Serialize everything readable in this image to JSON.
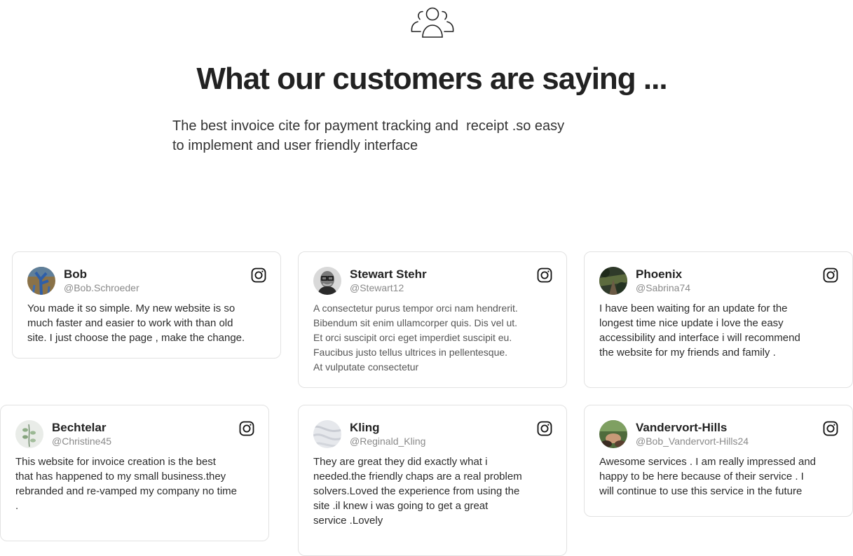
{
  "header": {
    "icon": "users-icon",
    "title": "What our customers are saying ...",
    "subtitle": "The best invoice cite for payment tracking and  receipt .so easy\nto implement and user friendly interface"
  },
  "testimonials": [
    {
      "name": "Bob",
      "handle": "@Bob.Schroeder",
      "avatar": "avatar-blue-tree",
      "social_icon": "instagram-icon",
      "text": "You made it so simple. My new website is so\nmuch faster and easier to work with than old\nsite. I just choose the page , make the change."
    },
    {
      "name": "Stewart Stehr",
      "handle": "@Stewart12",
      "avatar": "avatar-man-glasses",
      "social_icon": "instagram-icon",
      "text": "A consectetur purus tempor orci nam hendrerit.\nBibendum sit enim ullamcorper quis. Dis vel ut.\nEt orci suscipit orci eget imperdiet suscipit eu.\nFaucibus justo tellus ultrices in pellentesque.\nAt vulputate consectetur"
    },
    {
      "name": "Phoenix",
      "handle": "@Sabrina74",
      "avatar": "avatar-forest-path",
      "social_icon": "instagram-icon",
      "text": "I have been waiting for an update for the\nlongest time nice update i love the easy\naccessibility and interface i will recommend\nthe website for my friends and family ."
    },
    {
      "name": "Bechtelar",
      "handle": "@Christine45",
      "avatar": "avatar-eucalyptus",
      "social_icon": "instagram-icon",
      "text": "This website for invoice creation is the best\nthat has happened to my small business.they\nrebranded and re-vamped my company no time\n."
    },
    {
      "name": "Kling",
      "handle": "@Reginald_Kling",
      "avatar": "avatar-white-fabric",
      "social_icon": "instagram-icon",
      "text": "They are great they did exactly what i\nneeded.the friendly chaps are a real problem\nsolvers.Loved the experience from using the\nsite .il knew i was going to get a great\nservice .Lovely"
    },
    {
      "name": "Vandervort-Hills",
      "handle": "@Bob_Vandervort-Hills24",
      "avatar": "avatar-garden-hands",
      "social_icon": "instagram-icon",
      "text": "Awesome services . I am really impressed and\nhappy to be here because of their service . I\nwill continue to use this service in the future"
    }
  ]
}
